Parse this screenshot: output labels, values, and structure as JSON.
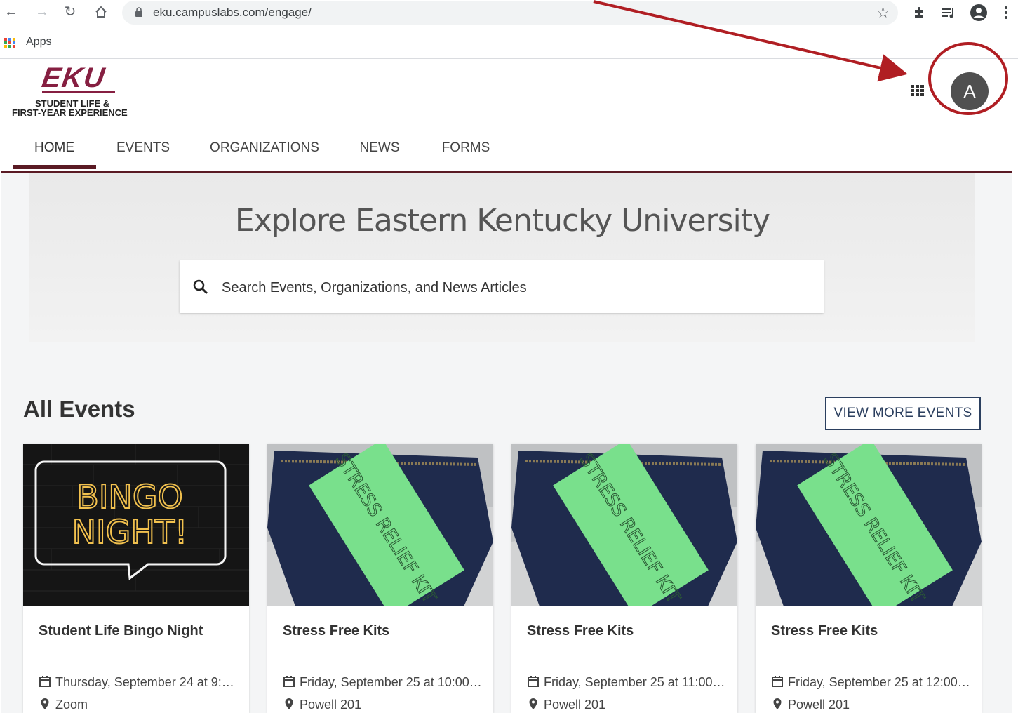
{
  "browser": {
    "url": "eku.campuslabs.com/engage/",
    "bookmarks_apps_label": "Apps"
  },
  "header": {
    "logo_main": "EKU",
    "logo_line1": "STUDENT LIFE &",
    "logo_line2": "FIRST-YEAR EXPERIENCE",
    "avatar_initial": "A"
  },
  "tabs": [
    {
      "label": "HOME",
      "active": true
    },
    {
      "label": "EVENTS",
      "active": false
    },
    {
      "label": "ORGANIZATIONS",
      "active": false
    },
    {
      "label": "NEWS",
      "active": false
    },
    {
      "label": "FORMS",
      "active": false
    }
  ],
  "hero": {
    "title": "Explore Eastern Kentucky University",
    "search_placeholder": "Search Events, Organizations, and News Articles"
  },
  "events": {
    "section_title": "All Events",
    "view_more_label": "VIEW MORE EVENTS",
    "cards": [
      {
        "title": "Student Life Bingo Night",
        "date": "Thursday, September 24 at 9:…",
        "location": "Zoom",
        "image_text_1": "BINGO",
        "image_text_2": "NIGHT!"
      },
      {
        "title": "Stress Free Kits",
        "date": "Friday, September 25 at 10:00…",
        "location": "Powell 201",
        "image_text": "STRESS RELIEF KIT"
      },
      {
        "title": "Stress Free Kits",
        "date": "Friday, September 25 at 11:00…",
        "location": "Powell 201",
        "image_text": "STRESS RELIEF KIT"
      },
      {
        "title": "Stress Free Kits",
        "date": "Friday, September 25 at 12:00…",
        "location": "Powell 201",
        "image_text": "STRESS RELIEF KIT"
      }
    ]
  },
  "colors": {
    "brand_maroon": "#861f41",
    "tab_rule": "#5a1a24",
    "button_navy": "#2b3f5f",
    "annotation_red": "#b01e23"
  }
}
